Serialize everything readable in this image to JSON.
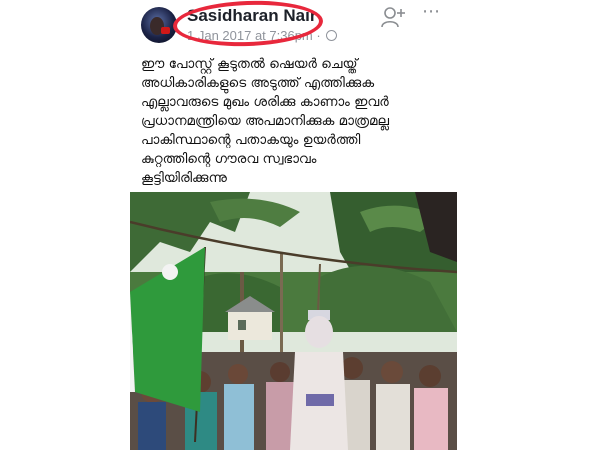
{
  "post": {
    "author": "Sasidharan Nair",
    "timestamp": "1 Jan 2017 at 7:36pm",
    "separator": "·",
    "privacy_icon": "globe-icon",
    "lines": [
      "ഈ പോസ്റ്റ് കൂടുതൽ ഷെയർ ചെയ്ത്",
      "അധികാരികളുടെ അടുത്ത് എത്തിക്കുക",
      "എല്ലാവരുടെ മുഖം ശരിക്കു കാണാം ഇവർ",
      "പ്രധാനമന്ത്രിയെ അപമാനിക്കുക മാത്രമല്ല",
      "പാകിസ്ഥാന്റെ പതാകയും ഉയർത്തി",
      "കുറ്റത്തിന്റെ ഗൗരവ സ്വഭാവം",
      "കൂട്ടിയിരിക്കുന്നു"
    ]
  },
  "actions": {
    "add_friend_icon": "add-friend-icon",
    "more_icon": "more-options-icon",
    "more_glyph": "⋯"
  },
  "annotation": {
    "highlight_color": "#e8283c"
  },
  "colors": {
    "name": "#1d2129",
    "meta": "#90949c",
    "flag_green": "#2f9a3c"
  }
}
